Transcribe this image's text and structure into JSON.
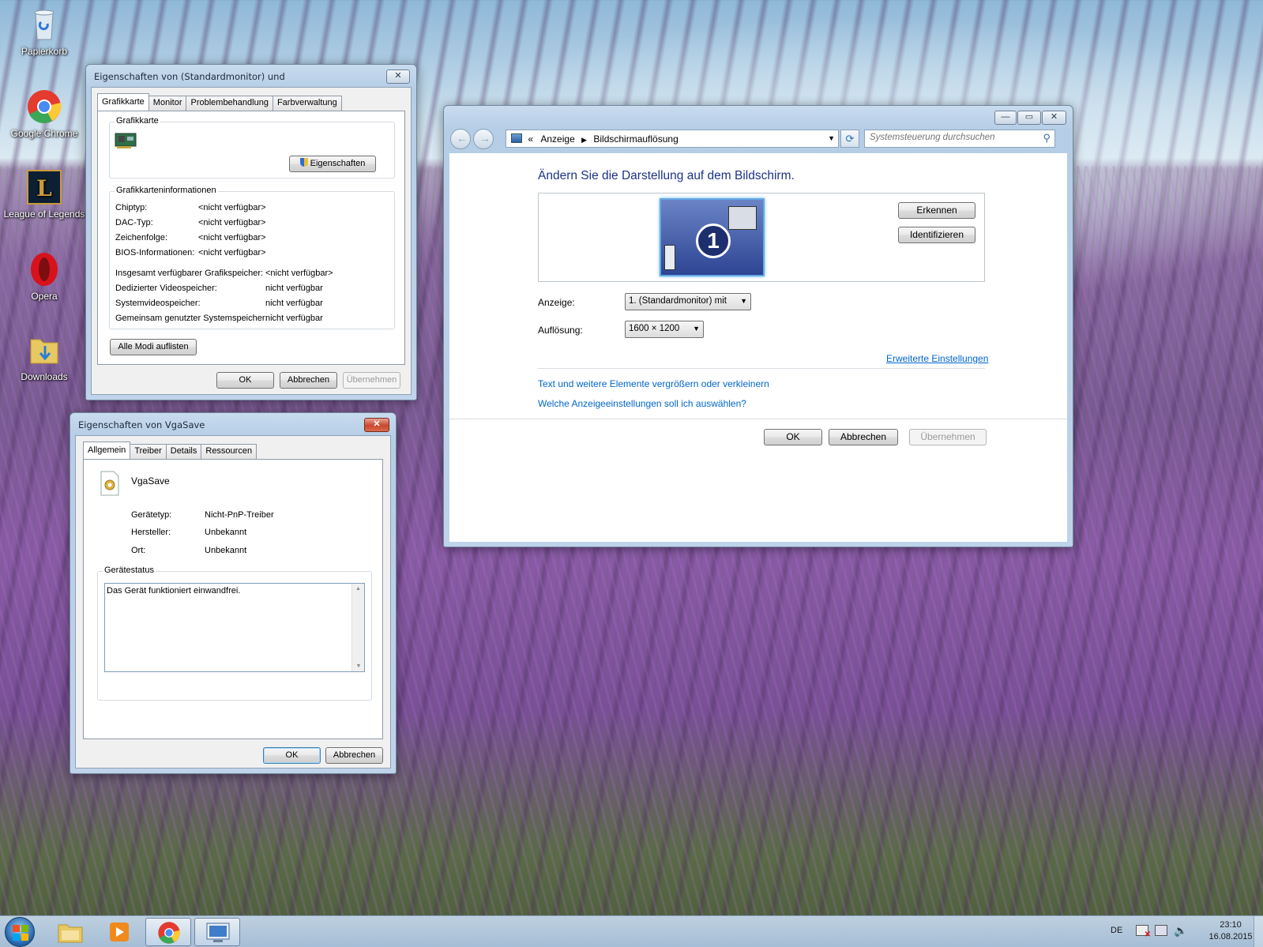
{
  "desktop": {
    "icons": [
      {
        "label": "Papierkorb",
        "icon": "recycle-bin-icon"
      },
      {
        "label": "Google Chrome",
        "icon": "chrome-icon"
      },
      {
        "label": "League of Legends",
        "icon": "league-of-legends-icon"
      },
      {
        "label": "Opera",
        "icon": "opera-icon"
      },
      {
        "label": "Downloads",
        "icon": "folder-downloads-icon"
      }
    ]
  },
  "monitor_props": {
    "title": "Eigenschaften von (Standardmonitor) und",
    "close_glyph": "✕",
    "tabs": [
      "Grafikkarte",
      "Monitor",
      "Problembehandlung",
      "Farbverwaltung"
    ],
    "adapter_group": "Grafikkarte",
    "properties_button": "Eigenschaften",
    "info_group": "Grafikkarteninformationen",
    "info_rows": [
      {
        "label": "Chiptyp:",
        "value": "<nicht verfügbar>"
      },
      {
        "label": "DAC-Typ:",
        "value": "<nicht verfügbar>"
      },
      {
        "label": "Zeichenfolge:",
        "value": "<nicht verfügbar>"
      },
      {
        "label": "BIOS-Informationen:",
        "value": "<nicht verfügbar>"
      }
    ],
    "memory_rows": [
      {
        "label": "Insgesamt verfügbarer Grafikspeicher:",
        "value": "<nicht verfügbar>"
      },
      {
        "label": "Dedizierter Videospeicher:",
        "value": "nicht verfügbar"
      },
      {
        "label": "Systemvideospeicher:",
        "value": "nicht verfügbar"
      },
      {
        "label": "Gemeinsam genutzter Systemspeicher:",
        "value": "nicht verfügbar"
      }
    ],
    "list_modes_button": "Alle Modi auflisten",
    "ok": "OK",
    "cancel": "Abbrechen",
    "apply": "Übernehmen"
  },
  "vga_props": {
    "title": "Eigenschaften von VgaSave",
    "close_glyph": "✕",
    "tabs": [
      "Allgemein",
      "Treiber",
      "Details",
      "Ressourcen"
    ],
    "device_name": "VgaSave",
    "rows": [
      {
        "label": "Gerätetyp:",
        "value": "Nicht-PnP-Treiber"
      },
      {
        "label": "Hersteller:",
        "value": "Unbekannt"
      },
      {
        "label": "Ort:",
        "value": "Unbekannt"
      }
    ],
    "status_group": "Gerätestatus",
    "status_text": "Das Gerät funktioniert einwandfrei.",
    "ok": "OK",
    "cancel": "Abbrechen"
  },
  "display_window": {
    "min_glyph": "—",
    "max_glyph": "▭",
    "close_glyph": "✕",
    "breadcrumb": [
      "«",
      "Anzeige",
      "Bildschirmauflösung"
    ],
    "search_placeholder": "Systemsteuerung durchsuchen",
    "heading": "Ändern Sie die Darstellung auf dem Bildschirm.",
    "monitor_number": "1",
    "detect_button": "Erkennen",
    "identify_button": "Identifizieren",
    "display_label": "Anzeige:",
    "display_value": "1. (Standardmonitor) mit",
    "resolution_label": "Auflösung:",
    "resolution_value": "1600 × 1200",
    "advanced_link": "Erweiterte Einstellungen",
    "links": [
      "Text und weitere Elemente vergrößern oder verkleinern",
      "Welche Anzeigeeinstellungen soll ich auswählen?"
    ],
    "ok": "OK",
    "cancel": "Abbrechen",
    "apply": "Übernehmen"
  },
  "taskbar": {
    "items": [
      "start-orb",
      "explorer-icon",
      "media-player-icon",
      "chrome-icon",
      "control-panel-icon"
    ],
    "language": "DE",
    "time": "23:10",
    "date": "16.08.2015"
  }
}
